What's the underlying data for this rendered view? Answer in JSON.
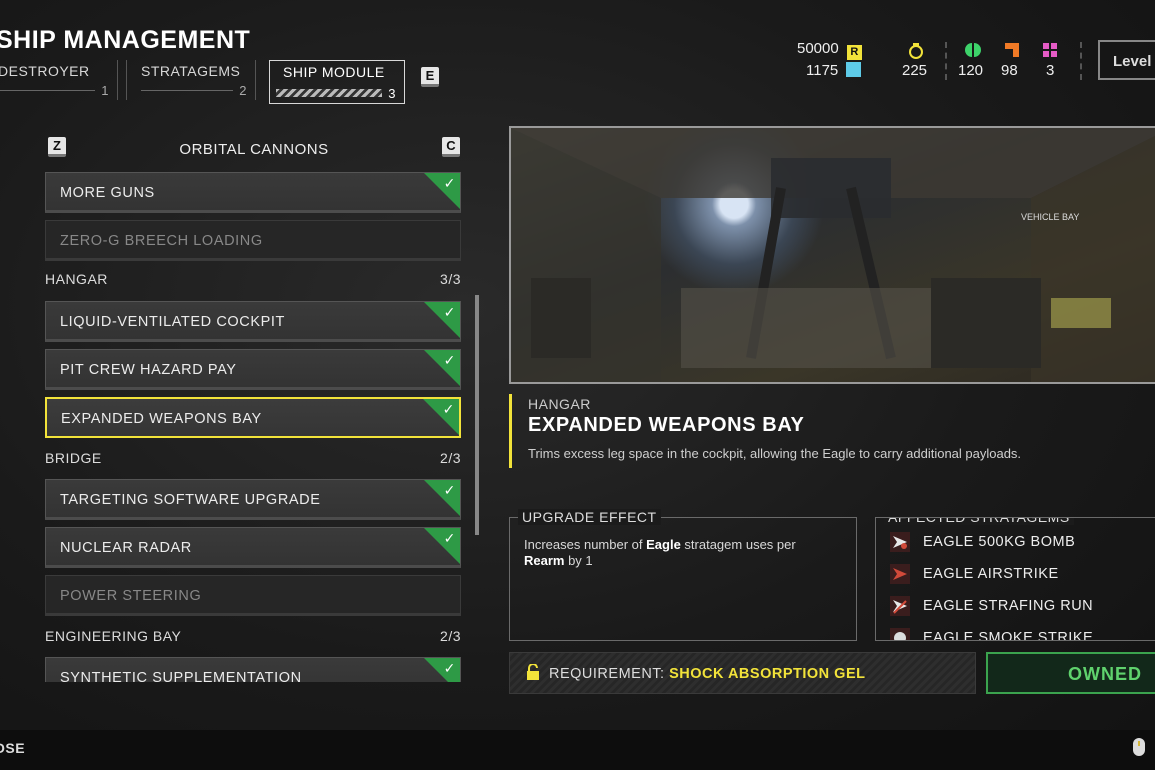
{
  "header": {
    "title": "SHIP MANAGEMENT",
    "tabs": [
      {
        "label": "DESTROYER",
        "num": "1"
      },
      {
        "label": "STRATAGEMS",
        "num": "2"
      },
      {
        "label": "SHIP MODULE",
        "num": "3"
      }
    ],
    "next_tab_key": "E",
    "level_label": "Level"
  },
  "resources": {
    "requisition": "50000",
    "medals": "1175",
    "super_credits": "225",
    "common_samples": "120",
    "rare_samples": "98",
    "super_samples": "3",
    "colors": {
      "requisition": "#f2e33a",
      "medals": "#5ecbe8",
      "common": "#3dd36a",
      "rare": "#f07a26",
      "super": "#e45bc6"
    }
  },
  "list": {
    "prev_key": "Z",
    "next_key": "C",
    "category": "ORBITAL CANNONS",
    "orbital_items": [
      {
        "label": "MORE GUNS",
        "state": "owned"
      },
      {
        "label": "ZERO-G BREECH LOADING",
        "state": "locked"
      }
    ],
    "hangar": {
      "label": "HANGAR",
      "count": "3/3"
    },
    "hangar_items": [
      {
        "label": "LIQUID-VENTILATED COCKPIT",
        "state": "owned"
      },
      {
        "label": "PIT CREW HAZARD PAY",
        "state": "owned"
      },
      {
        "label": "EXPANDED WEAPONS BAY",
        "state": "selected"
      }
    ],
    "bridge": {
      "label": "BRIDGE",
      "count": "2/3"
    },
    "bridge_items": [
      {
        "label": "TARGETING SOFTWARE UPGRADE",
        "state": "owned"
      },
      {
        "label": "NUCLEAR RADAR",
        "state": "owned"
      },
      {
        "label": "POWER STEERING",
        "state": "locked"
      }
    ],
    "engineering": {
      "label": "ENGINEERING BAY",
      "count": "2/3"
    },
    "engineering_items": [
      {
        "label": "SYNTHETIC SUPPLEMENTATION",
        "state": "owned"
      }
    ]
  },
  "detail": {
    "category": "HANGAR",
    "title": "EXPANDED WEAPONS BAY",
    "description": "Trims excess leg space in the cockpit, allowing the Eagle to carry additional payloads.",
    "upgrade_effect_title": "UPGRADE EFFECT",
    "upgrade_effect_parts": [
      "Increases number of ",
      "Eagle",
      " stratagem uses per ",
      "Rearm",
      " by 1"
    ],
    "affected_title": "AFFECTED STRATAGEMS",
    "affected": [
      "EAGLE 500KG BOMB",
      "EAGLE AIRSTRIKE",
      "EAGLE STRAFING RUN",
      "EAGLE SMOKE STRIKE"
    ],
    "requirement_label": "REQUIREMENT:",
    "requirement_value": "SHOCK ABSORPTION GEL",
    "status": "OWNED",
    "preview_sign": "VEHICLE BAY"
  },
  "footer": {
    "close_label": "OSE"
  }
}
